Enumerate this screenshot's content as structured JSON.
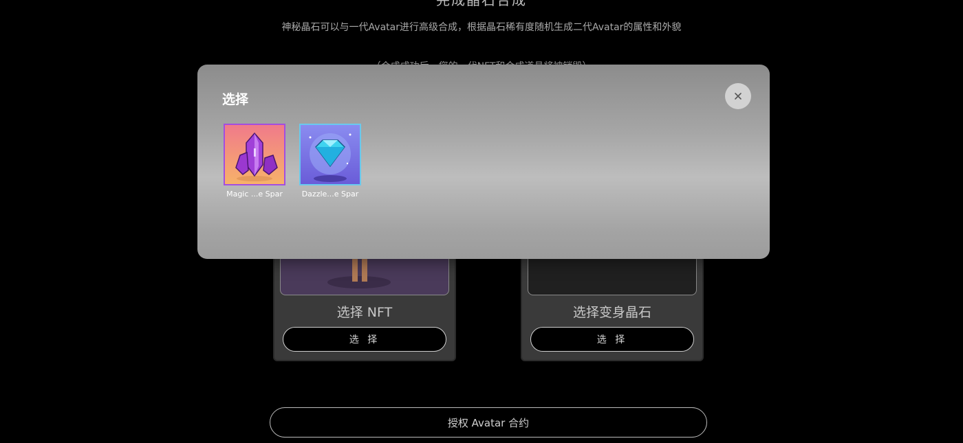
{
  "page": {
    "heading": "完成晶石合成",
    "description": "神秘晶石可以与一代Avatar进行高级合成，根据晶石稀有度随机生成二代Avatar的属性和外貌",
    "note": "（合成成功后，您的一代NFT和合成道具将被销毁）"
  },
  "cards": [
    {
      "title": "选择 NFT",
      "button_label": "选 择"
    },
    {
      "title": "选择变身晶石",
      "button_label": "选 择"
    }
  ],
  "authorize_button_label": "授权 Avatar 合约",
  "modal": {
    "title": "选择",
    "close_icon": "close-icon",
    "items": [
      {
        "label": "Magic ...e Spar",
        "icon": "purple-crystal-icon",
        "border_color": "#a34de0"
      },
      {
        "label": "Dazzle...e Spar",
        "icon": "blue-diamond-icon",
        "border_color": "#69c9ee"
      }
    ]
  },
  "colors": {
    "background": "#000000",
    "modal_gradient_top": "#8c8c8c",
    "modal_gradient_mid": "#bdbdbd",
    "card_background": "#3a3a3a"
  }
}
